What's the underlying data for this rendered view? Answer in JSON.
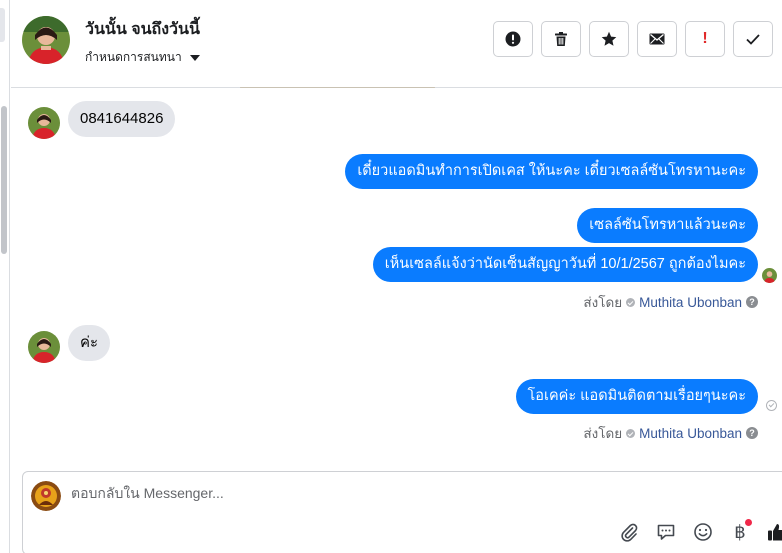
{
  "header": {
    "contact_name": "วันนั้น จนถึงวันนี้",
    "assign_label": "กำหนดการสนทนา",
    "actions": [
      {
        "name": "spam-button",
        "icon": "alert-circle-icon"
      },
      {
        "name": "delete-button",
        "icon": "trash-icon"
      },
      {
        "name": "star-button",
        "icon": "star-icon"
      },
      {
        "name": "mark-unread-button",
        "icon": "envelope-icon"
      },
      {
        "name": "follow-up-button",
        "icon": "exclamation-icon"
      },
      {
        "name": "mark-done-button",
        "icon": "check-icon"
      }
    ]
  },
  "messages": {
    "m1": "0841644826",
    "m2": "เดี๋ยวแอดมินทำการเปิดเคส ให้นะคะ เดี๋ยวเซลล์ซันโทรหานะคะ",
    "m3": "เซลล์ซันโทรหาแล้วนะคะ",
    "m4": "เห็นเซลล์แจ้งว่านัดเซ็นสัญญาวันที่ 10/1/2567 ถูกต้องไมคะ",
    "m5": "ค่ะ",
    "m6": "โอเคค่ะ แอดมินติดตามเรื่อยๆนะคะ"
  },
  "sent_by": {
    "prefix": "ส่งโดย",
    "agent": "Muthita Ubonban",
    "help": "?"
  },
  "composer": {
    "placeholder": "ตอบกลับใน Messenger...",
    "baht_symbol": "฿",
    "exclamation": "!"
  },
  "colors": {
    "outgoing_bubble": "#0a7cff",
    "incoming_bubble": "#e4e6eb",
    "notify": "#f02849",
    "agent_link": "#385898"
  }
}
